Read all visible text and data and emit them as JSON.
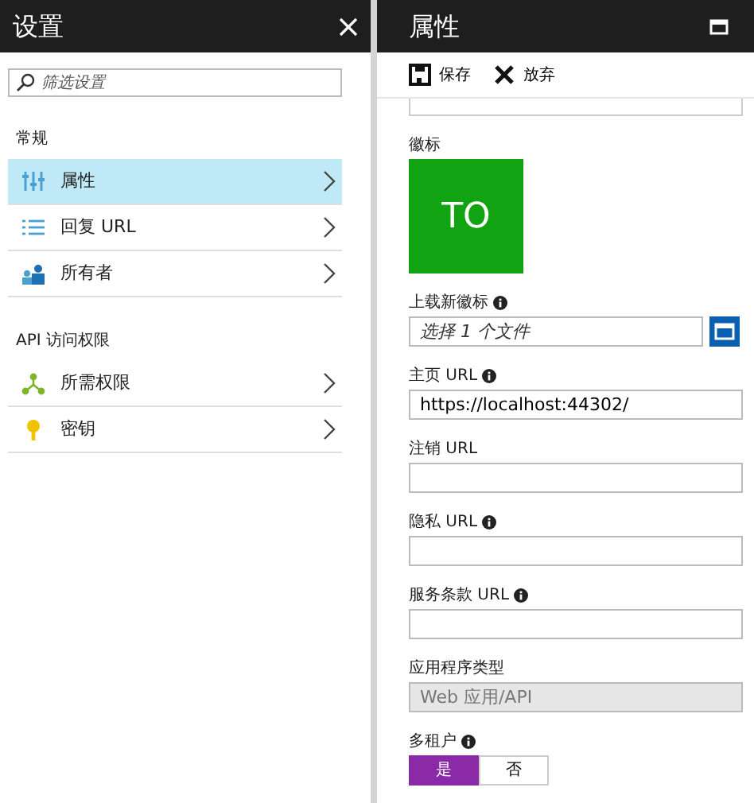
{
  "settings_pane": {
    "title": "设置",
    "search": {
      "placeholder": "筛选设置"
    },
    "sections": [
      {
        "heading": "常规",
        "items": [
          {
            "label": "属性",
            "selected": true
          },
          {
            "label": "回复 URL",
            "selected": false
          },
          {
            "label": "所有者",
            "selected": false
          }
        ]
      },
      {
        "heading": "API 访问权限",
        "items": [
          {
            "label": "所需权限",
            "selected": false
          },
          {
            "label": "密钥",
            "selected": false
          }
        ]
      }
    ]
  },
  "properties_pane": {
    "title": "属性",
    "toolbar": [
      {
        "label": "保存"
      },
      {
        "label": "放弃"
      }
    ],
    "logo": {
      "label": "徽标",
      "text": "TO"
    },
    "fields": [
      {
        "kind": "file",
        "label": "上载新徽标",
        "info": true,
        "placeholder": "选择 1 个文件"
      },
      {
        "kind": "text",
        "label": "主页 URL",
        "info": true,
        "value": "https://localhost:44302/"
      },
      {
        "kind": "text",
        "label": "注销 URL",
        "info": false
      },
      {
        "kind": "text",
        "label": "隐私 URL",
        "info": true
      },
      {
        "kind": "text",
        "label": "服务条款 URL",
        "info": true
      },
      {
        "kind": "text",
        "label": "应用程序类型",
        "info": false,
        "value": "Web 应用/API",
        "disabled": true
      },
      {
        "kind": "toggle",
        "label": "多租户",
        "info": true,
        "options": [
          {
            "label": "是",
            "selected": true
          },
          {
            "label": "否",
            "selected": false
          }
        ]
      }
    ]
  }
}
